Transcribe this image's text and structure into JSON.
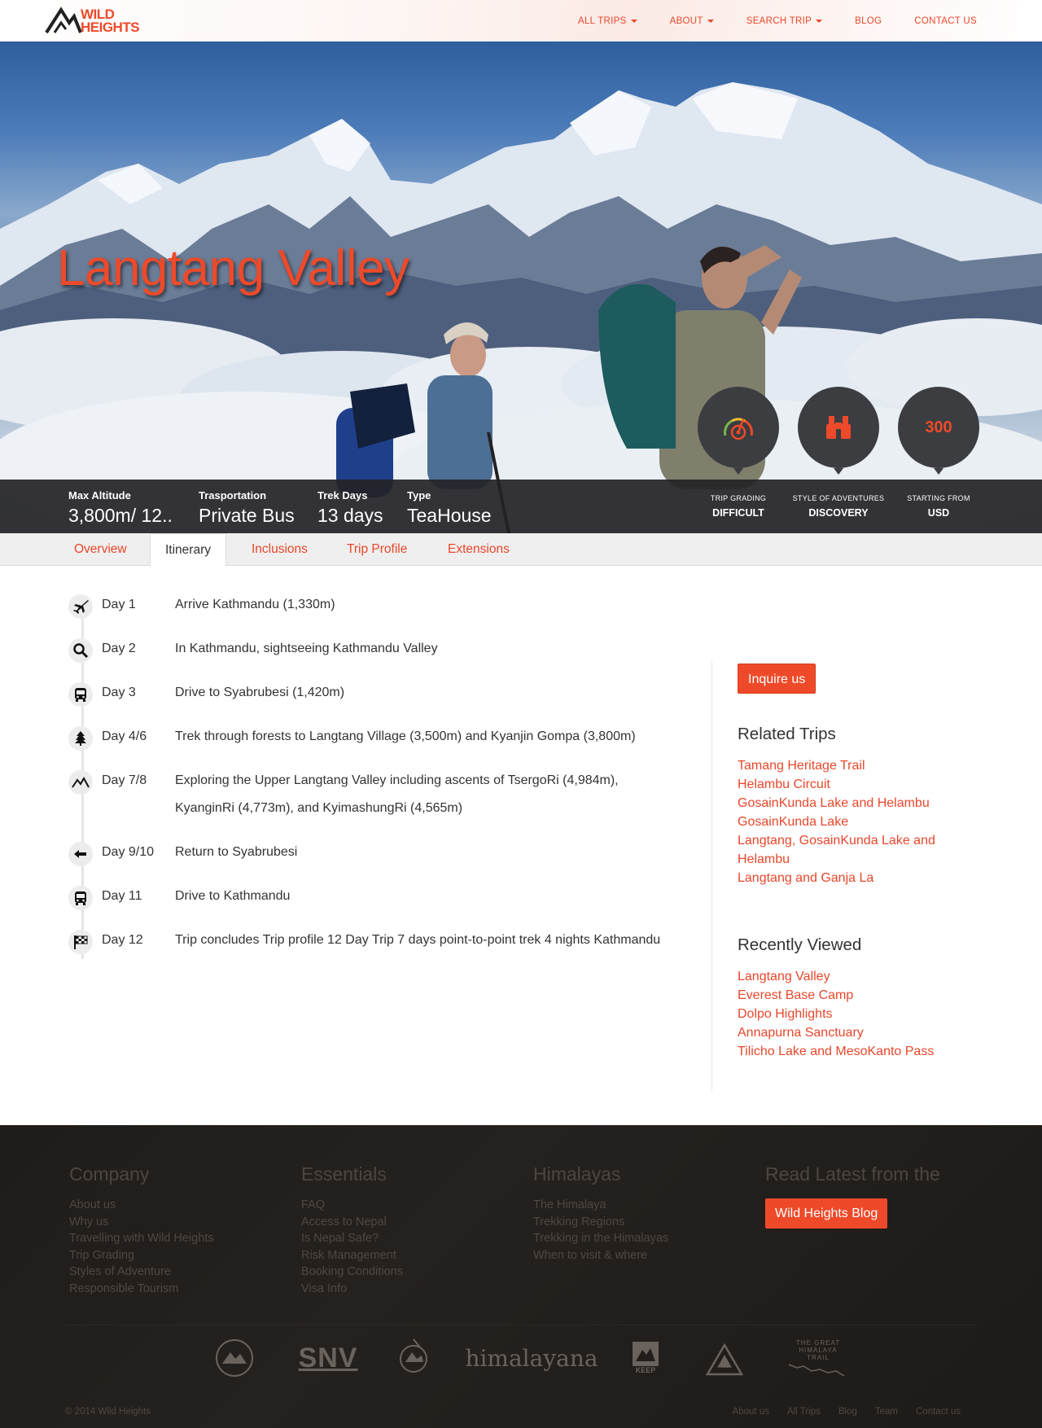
{
  "header": {
    "logo_text_line1": "WILD",
    "logo_text_line2": "HEIGHTS",
    "nav": [
      {
        "label": "ALL TRIPS",
        "dropdown": true
      },
      {
        "label": "ABOUT",
        "dropdown": true
      },
      {
        "label": "SEARCH TRIP",
        "dropdown": true
      },
      {
        "label": "BLOG",
        "dropdown": false
      },
      {
        "label": "CONTACT US",
        "dropdown": false
      }
    ]
  },
  "hero": {
    "title": "Langtang Valley",
    "circle_price": "300",
    "info": [
      {
        "label": "Max Altitude",
        "value": "3,800m/ 12.."
      },
      {
        "label": "Trasportation",
        "value": "Private Bus"
      },
      {
        "label": "Trek Days",
        "value": "13 days"
      },
      {
        "label": "Type",
        "value": "TeaHouse"
      }
    ],
    "stats": [
      {
        "label": "TRIP GRADING",
        "value": "DIFFICULT"
      },
      {
        "label": "STYLE OF ADVENTURES",
        "value": "DISCOVERY"
      },
      {
        "label": "STARTING FROM",
        "value": "USD"
      }
    ]
  },
  "tabs": [
    "Overview",
    "Itinerary",
    "Inclusions",
    "Trip Profile",
    "Extensions"
  ],
  "itinerary": [
    {
      "icon": "plane-icon",
      "day": "Day 1",
      "desc": "Arrive Kathmandu (1,330m)"
    },
    {
      "icon": "search-icon",
      "day": "Day 2",
      "desc": "In Kathmandu, sightseeing Kathmandu Valley"
    },
    {
      "icon": "bus-icon",
      "day": "Day 3",
      "desc": "Drive to Syabrubesi (1,420m)"
    },
    {
      "icon": "tree-icon",
      "day": "Day 4/6",
      "desc": "Trek through forests to Langtang Village (3,500m) and Kyanjin Gompa (3,800m)"
    },
    {
      "icon": "mountain-icon",
      "day": "Day 7/8",
      "desc": "Exploring the Upper Langtang Valley including ascents of TsergoRi (4,984m), KyanginRi (4,773m), and KyimashungRi (4,565m)"
    },
    {
      "icon": "arrow-left-icon",
      "day": "Day 9/10",
      "desc": "Return to Syabrubesi"
    },
    {
      "icon": "bus-icon",
      "day": "Day 11",
      "desc": "Drive to Kathmandu"
    },
    {
      "icon": "checkered-flag-icon",
      "day": "Day 12",
      "desc": "Trip concludes Trip profile 12 Day Trip 7 days point-to-point trek 4 nights Kathmandu"
    }
  ],
  "sidebar": {
    "inquire_label": "Inquire us",
    "related_title": "Related Trips",
    "related": [
      "Tamang Heritage Trail",
      "Helambu Circuit",
      "GosainKunda Lake and Helambu",
      "GosainKunda Lake",
      "Langtang, GosainKunda Lake and Helambu",
      "Langtang and Ganja La"
    ],
    "recent_title": "Recently Viewed",
    "recent": [
      "Langtang Valley",
      "Everest Base Camp",
      "Dolpo Highlights",
      "Annapurna Sanctuary",
      "Tilicho Lake and MesoKanto Pass"
    ]
  },
  "footer": {
    "company_title": "Company",
    "company": [
      "About us",
      "Why us",
      "Travelling with Wild Heights",
      "Trip Grading",
      "Styles of Adventure",
      "Responsible Tourism"
    ],
    "essentials_title": "Essentials",
    "essentials": [
      "FAQ",
      "Access to Nepal",
      "Is Nepal Safe?",
      "Risk Management",
      "Booking Conditions",
      "Visa Info"
    ],
    "himalayas_title": "Himalayas",
    "himalayas": [
      "The Himalaya",
      "Trekking Regions",
      "Trekking in the Himalayas",
      "When to visit & where"
    ],
    "blog_title": "Read Latest from the",
    "blog_button": "Wild Heights Blog",
    "partners": [
      "SNV",
      "himalayana",
      "KEEP",
      "SMA",
      "THE GREAT HIMALAYA TRAIL"
    ],
    "copyright": "© 2014 Wild Heights",
    "bottom_links": [
      "About us",
      "All Trips",
      "Blog",
      "Team",
      "Contact us"
    ]
  },
  "colors": {
    "accent": "#ee4a2a",
    "footer_bg": "#211e1b",
    "info_bar": "#232326"
  }
}
